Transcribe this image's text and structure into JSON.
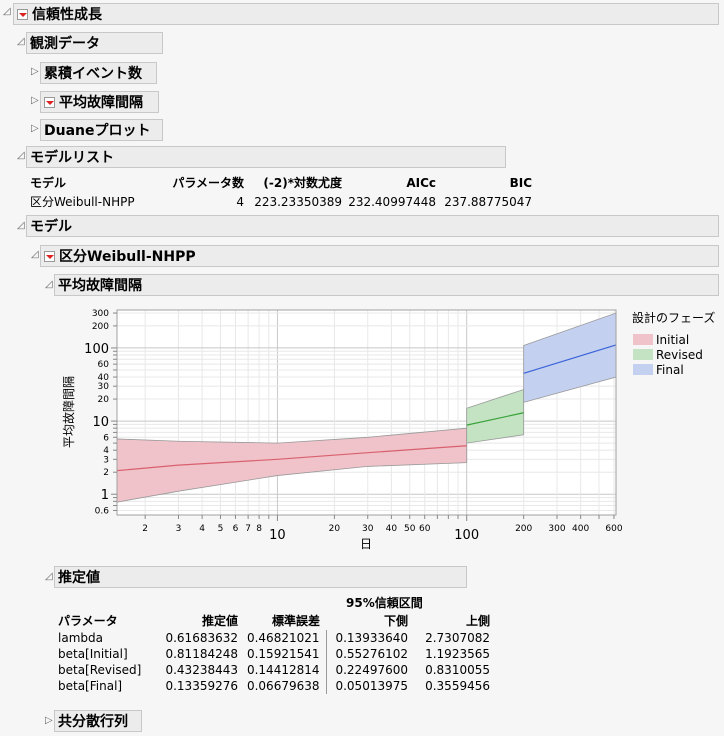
{
  "report": {
    "title": "信頼性成長",
    "observed": {
      "title": "観測データ",
      "children": [
        {
          "label": "累積イベント数",
          "has_menu": false
        },
        {
          "label": "平均故障間隔",
          "has_menu": true
        },
        {
          "label": "Duaneプロット",
          "has_menu": false
        }
      ]
    },
    "model_list": {
      "title": "モデルリスト",
      "headers": [
        "モデル",
        "パラメータ数",
        "(-2)*対数尤度",
        "AICc",
        "BIC"
      ],
      "rows": [
        [
          "区分Weibull-NHPP",
          "4",
          "223.23350389",
          "232.40997448",
          "237.88775047"
        ]
      ]
    },
    "models": {
      "title": "モデル",
      "model_name": "区分Weibull-NHPP",
      "mtbf_title": "平均故障間隔",
      "estimates": {
        "title": "推定値",
        "ci_header": "95%信頼区間",
        "headers": [
          "パラメータ",
          "推定値",
          "標準誤差",
          "下側",
          "上側"
        ],
        "rows": [
          [
            "lambda",
            "0.61683632",
            "0.46821021",
            "0.13933640",
            "2.7307082"
          ],
          [
            "beta[Initial]",
            "0.81184248",
            "0.15921541",
            "0.55276102",
            "1.1923565"
          ],
          [
            "beta[Revised]",
            "0.43238443",
            "0.14412814",
            "0.22497600",
            "0.8310055"
          ],
          [
            "beta[Final]",
            "0.13359276",
            "0.06679638",
            "0.05013975",
            "0.3559456"
          ]
        ]
      },
      "covariance_title": "共分散行列"
    }
  },
  "chart_data": {
    "type": "area",
    "title": "",
    "xlabel": "日",
    "ylabel": "平均故障間隔",
    "xscale": "log",
    "yscale": "log",
    "xlim": [
      1.42,
      615
    ],
    "ylim": [
      0.52,
      330
    ],
    "x_major_ticks": [
      "10",
      "100"
    ],
    "x_minor_ticks": [
      "2",
      "3",
      "4",
      "5",
      "6",
      "7",
      "8",
      "20",
      "30",
      "40",
      "50",
      "60",
      "200",
      "300",
      "400",
      "600"
    ],
    "y_major_ticks": [
      "1",
      "10",
      "100"
    ],
    "y_minor_ticks": [
      "0.6",
      "2",
      "3",
      "4",
      "6",
      "20",
      "30",
      "40",
      "60",
      "200",
      "300"
    ],
    "grid": true,
    "legend": {
      "title": "設計のフェーズ",
      "position": "right"
    },
    "series": [
      {
        "name": "Initial",
        "color": "#d9606e",
        "fill": "#efc3c9",
        "x": [
          1.42,
          3,
          10,
          30,
          100
        ],
        "mean": [
          2.1,
          2.5,
          3.0,
          3.7,
          4.6
        ],
        "lower": [
          0.78,
          1.1,
          1.8,
          2.4,
          2.7
        ],
        "upper": [
          5.7,
          5.3,
          5.0,
          6.0,
          8.0
        ]
      },
      {
        "name": "Revised",
        "color": "#3aa23a",
        "fill": "#c3e3c3",
        "x": [
          100,
          200
        ],
        "mean": [
          8.8,
          13
        ],
        "lower": [
          5.0,
          6.5
        ],
        "upper": [
          15,
          27
        ]
      },
      {
        "name": "Final",
        "color": "#3a64d8",
        "fill": "#c4d0f0",
        "x": [
          200,
          615
        ],
        "mean": [
          45,
          110
        ],
        "lower": [
          18,
          40
        ],
        "upper": [
          108,
          300
        ]
      }
    ]
  }
}
